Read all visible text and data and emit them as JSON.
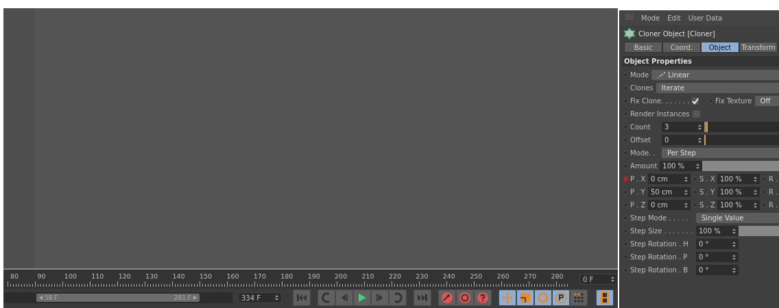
{
  "menu": [
    "Mode",
    "Edit",
    "User Data"
  ],
  "object_title": "Cloner Object [Cloner]",
  "tabs": [
    {
      "label": "Basic",
      "selected": false
    },
    {
      "label": "Coord.",
      "selected": false
    },
    {
      "label": "Object",
      "selected": true
    },
    {
      "label": "Transform",
      "selected": false
    }
  ],
  "section": "Object Properties",
  "mode": {
    "label": "Mode",
    "value": "Linear"
  },
  "clones": {
    "label": "Clones",
    "value": "Iterate"
  },
  "fix_clone": {
    "label": "Fix Clone. . . . . . .",
    "checked": true
  },
  "fix_texture": {
    "label": "Fix Texture",
    "value": "Off"
  },
  "render_instances": {
    "label": "Render Instances",
    "checked": false
  },
  "count": {
    "label": "Count",
    "value": "3",
    "level": 0.03
  },
  "offset": {
    "label": "Offset",
    "value": "0",
    "level": 0
  },
  "transform_mode": {
    "label": "Mode. .",
    "value": "Per Step"
  },
  "amount": {
    "label": "Amount",
    "value": "100 %",
    "level": 1
  },
  "transform_rows": [
    {
      "cells": [
        {
          "label": "P . X",
          "value": "0 cm",
          "keyed": true
        },
        {
          "label": "S . X",
          "value": "100 %",
          "keyed": false
        },
        {
          "label": "R .",
          "keyed": false
        }
      ]
    },
    {
      "cells": [
        {
          "label": "P . Y",
          "value": "50 cm",
          "keyed": false
        },
        {
          "label": "S . Y",
          "value": "100 %",
          "keyed": false
        },
        {
          "label": "R .",
          "keyed": false
        }
      ]
    },
    {
      "cells": [
        {
          "label": "P . Z",
          "value": "0 cm",
          "keyed": false
        },
        {
          "label": "S . Z",
          "value": "100 %",
          "keyed": false
        },
        {
          "label": "R .",
          "keyed": false
        }
      ]
    }
  ],
  "step_mode": {
    "label": "Step Mode . . . . .",
    "value": "Single Value"
  },
  "step_size": {
    "label": "Step Size . . . . . . .",
    "value": "100 %",
    "level": 1
  },
  "step_rotations": [
    {
      "label": "Step Rotation . H",
      "value": "0 °"
    },
    {
      "label": "Step Rotation . P",
      "value": "0 °"
    },
    {
      "label": "Step Rotation . B",
      "value": "0 °"
    }
  ],
  "timeline": {
    "ticks": [
      "80",
      "90",
      "100",
      "110",
      "120",
      "130",
      "140",
      "150",
      "160",
      "170",
      "180",
      "190",
      "200",
      "210",
      "220",
      "230",
      "240",
      "250",
      "260",
      "270",
      "280"
    ],
    "current_frame": "0 F",
    "range_start": "58 F",
    "range_end": "281 F",
    "end_frame": "334 F"
  }
}
